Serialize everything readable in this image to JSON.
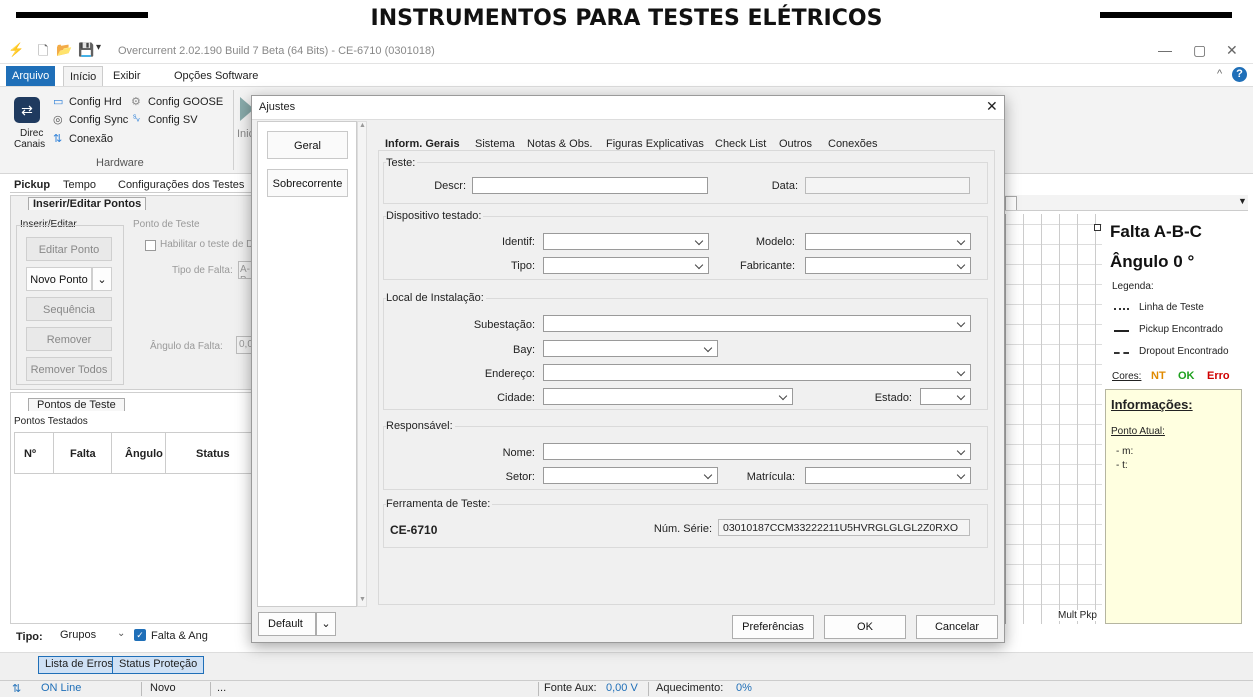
{
  "banner": {
    "title": "INSTRUMENTOS PARA TESTES ELÉTRICOS"
  },
  "window": {
    "title": "Overcurrent 2.02.190 Build 7 Beta (64 Bits) - CE-6710 (0301018)",
    "minimize": "—",
    "maximize": "▢",
    "close": "✕"
  },
  "menu": {
    "items": [
      "Arquivo",
      "Início",
      "Exibir",
      "Opções Software"
    ]
  },
  "ribbon": {
    "direc": "Direc",
    "canais": "Canais",
    "config_hrd": "Config Hrd",
    "config_goose": "Config GOOSE",
    "config_sync": "Config Sync",
    "config_sv": "Config SV",
    "conexao": "Conexão",
    "hardware": "Hardware",
    "inic": "Inic"
  },
  "tabs": {
    "pickup": "Pickup",
    "tempo": "Tempo",
    "config_testes": "Configurações dos Testes"
  },
  "left": {
    "inserir_tab": "Inserir/Editar Pontos",
    "inserir_group": "Inserir/Editar",
    "editar_ponto": "Editar Ponto",
    "novo_ponto": "Novo Ponto",
    "sequencia": "Sequência",
    "remover": "Remover",
    "remover_todos": "Remover Todos",
    "ponto_teste_group": "Ponto de Teste",
    "habilitar": "Habilitar o teste de Dr",
    "tipo_falta": "Tipo de Falta:",
    "tipo_falta_value": "A-B",
    "angulo_falta": "Ângulo da Falta:",
    "angulo_value": "0,0",
    "pontos_tab": "Pontos de Teste",
    "pontos_testados": "Pontos Testados",
    "cols": [
      "Nº",
      "Falta",
      "Ângulo",
      "Status"
    ],
    "tipo_label": "Tipo:",
    "tipo_value": "Grupos",
    "falta_ang": "Falta & Ang"
  },
  "right": {
    "falta": "Falta A-B-C",
    "angulo": "Ângulo 0 °",
    "legenda": "Legenda:",
    "legend": [
      "Linha de Teste",
      "Pickup Encontrado",
      "Dropout Encontrado"
    ],
    "cores": "Cores:",
    "nt": "NT",
    "ok": "OK",
    "erro": "Erro",
    "info_title": "Informações:",
    "ponto_atual": "Ponto Atual:",
    "m": "- m:",
    "t": "- t:",
    "mult_pkp": "Mult Pkp"
  },
  "bottom_tabs": [
    "Lista de Erros",
    "Status Proteção"
  ],
  "status": {
    "online": "ON Line",
    "novo": "Novo",
    "dots": "...",
    "fonte_aux": "Fonte Aux:",
    "fonte_val": "0,00 V",
    "aquecimento": "Aquecimento:",
    "aquec_val": "0%"
  },
  "dialog": {
    "title": "Ajustes",
    "side": [
      "Geral",
      "Sobrecorrente"
    ],
    "tabs": [
      "Inform. Gerais",
      "Sistema",
      "Notas & Obs.",
      "Figuras Explicativas",
      "Check List",
      "Outros",
      "Conexões"
    ],
    "teste_group": "Teste:",
    "descr": "Descr:",
    "data": "Data:",
    "disp_group": "Dispositivo testado:",
    "identif": "Identif:",
    "modelo": "Modelo:",
    "tipo": "Tipo:",
    "fabricante": "Fabricante:",
    "local_group": "Local de Instalação:",
    "subestacao": "Subestação:",
    "bay": "Bay:",
    "endereco": "Endereço:",
    "cidade": "Cidade:",
    "estado": "Estado:",
    "resp_group": "Responsável:",
    "nome": "Nome:",
    "setor": "Setor:",
    "matricula": "Matrícula:",
    "ferr_group": "Ferramenta de Teste:",
    "ferr_model": "CE-6710",
    "num_serie": "Núm. Série:",
    "num_serie_value": "03010187CCM33222211U5HVRGLGLGL2Z0RXO",
    "default": "Default",
    "preferencias": "Preferências",
    "ok": "OK",
    "cancelar": "Cancelar"
  }
}
